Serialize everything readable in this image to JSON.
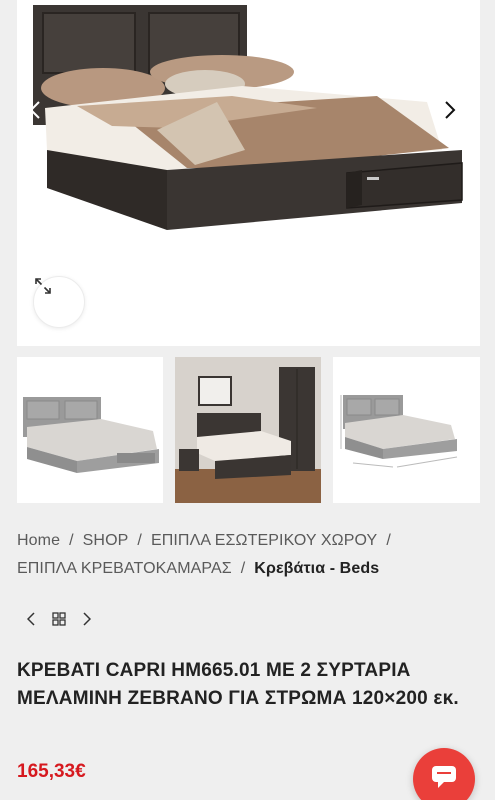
{
  "gallery": {
    "main_image_alt": "",
    "thumbnails": [
      "",
      "",
      ""
    ]
  },
  "breadcrumb": {
    "items": [
      "Home",
      "SHOP",
      "ΕΠΙΠΛΑ ΕΣΩΤΕΡΙΚΟΥ ΧΩΡΟΥ",
      "ΕΠΙΠΛΑ ΚΡΕΒΑΤΟΚΑΜΑΡΑΣ"
    ],
    "current": "Κρεβάτια - Beds",
    "separator": "/"
  },
  "product": {
    "title": "ΚΡΕΒΑΤΙ CAPRI HM665.01 ΜΕ 2 ΣΥΡΤΑΡΙΑ ΜΕΛΑΜΙΝΗ ZEBRANO ΓΙΑ ΣΤΡΩΜΑ 120×200 εκ.",
    "price": "165,33€"
  },
  "icons": {
    "gallery_prev": "chevron-left-icon",
    "gallery_next": "chevron-right-icon",
    "zoom": "expand-icon",
    "nav_prev": "chevron-left-icon",
    "nav_grid": "grid-icon",
    "nav_next": "chevron-right-icon",
    "chat": "chat-icon"
  },
  "colors": {
    "price": "#d6191f",
    "chat_button": "#ea3f3a",
    "page_bg": "#efefef"
  }
}
